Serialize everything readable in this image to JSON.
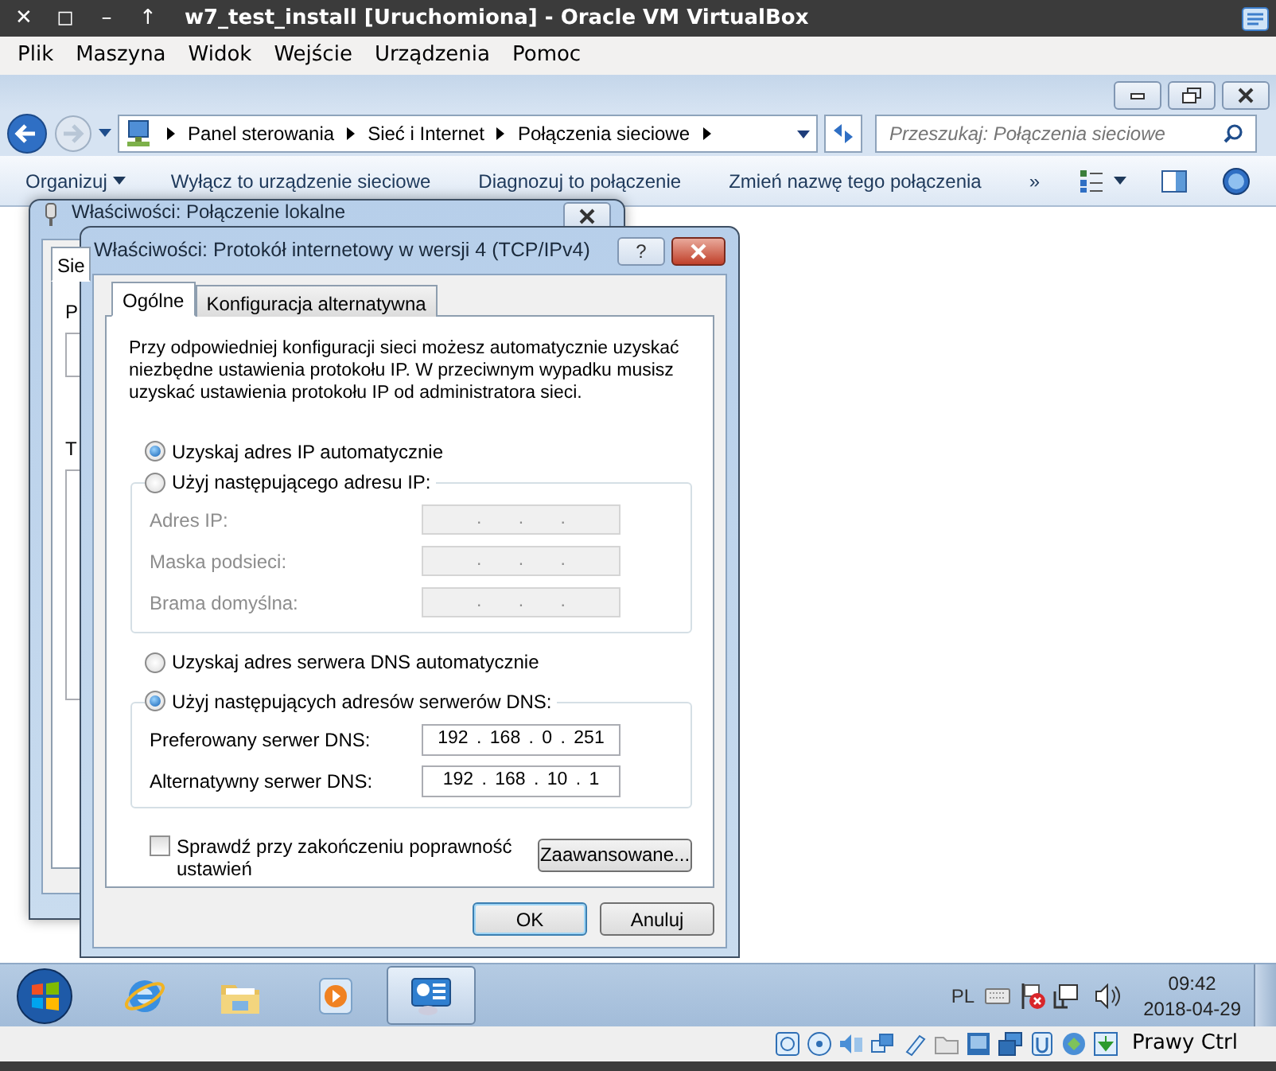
{
  "host_window": {
    "controls": [
      "✕",
      "◻",
      "–",
      "↑"
    ],
    "title": "w7_test_install [Uruchomiona] - Oracle VM VirtualBox"
  },
  "host_menu": [
    "Plik",
    "Maszyna",
    "Widok",
    "Wejście",
    "Urządzenia",
    "Pomoc"
  ],
  "explorer": {
    "breadcrumb": [
      "Panel sterowania",
      "Sieć i Internet",
      "Połączenia sieciowe"
    ],
    "search": {
      "placeholder": "Przeszukaj: Połączenia sieciowe"
    },
    "toolbar": [
      {
        "label": "Organizuj",
        "dropdown": true
      },
      {
        "label": "Wyłącz to urządzenie sieciowe",
        "dropdown": false
      },
      {
        "label": "Diagnozuj to połączenie",
        "dropdown": false
      },
      {
        "label": "Zmień nazwę tego połączenia",
        "dropdown": false
      },
      {
        "label": "»",
        "dropdown": false
      }
    ]
  },
  "back_dialog": {
    "title": "Właściwości: Połączenie lokalne",
    "tab": "Sie",
    "labels": [
      "P",
      "T"
    ]
  },
  "dialog": {
    "title": "Właściwości: Protokół internetowy w wersji 4 (TCP/IPv4)",
    "help_button": "?",
    "tabs": [
      {
        "label": "Ogólne",
        "selected": true
      },
      {
        "label": "Konfiguracja alternatywna",
        "selected": false
      }
    ],
    "intro": "Przy odpowiedniej konfiguracji sieci możesz automatycznie uzyskać niezbędne ustawienia protokołu IP. W przeciwnym wypadku musisz uzyskać ustawienia protokołu IP od administratora sieci.",
    "ip_options": [
      {
        "label": "Uzyskaj adres IP automatycznie",
        "selected": true
      },
      {
        "label": "Użyj następującego adresu IP:",
        "selected": false
      }
    ],
    "ip_fields": [
      {
        "label": "Adres IP:",
        "value": ". . .",
        "disabled": true
      },
      {
        "label": "Maska podsieci:",
        "value": ". . .",
        "disabled": true
      },
      {
        "label": "Brama domyślna:",
        "value": ". . .",
        "disabled": true
      }
    ],
    "dns_options": [
      {
        "label": "Uzyskaj adres serwera DNS automatycznie",
        "selected": false
      },
      {
        "label": "Użyj następujących adresów serwerów DNS:",
        "selected": true
      }
    ],
    "dns_fields": [
      {
        "label": "Preferowany serwer DNS:",
        "value": "192 . 168 . 0 . 251",
        "disabled": false
      },
      {
        "label": "Alternatywny serwer DNS:",
        "value": "192 . 168 . 10 . 1",
        "disabled": false
      }
    ],
    "validate": {
      "label": "Sprawdź przy zakończeniu poprawność ustawień",
      "checked": false
    },
    "advanced_button": "Zaawansowane...",
    "buttons": [
      {
        "label": "OK",
        "default": true
      },
      {
        "label": "Anuluj",
        "default": false
      }
    ]
  },
  "taskbar": {
    "apps": [
      {
        "kind": "browser",
        "selected": false
      },
      {
        "kind": "folder",
        "selected": false
      },
      {
        "kind": "media",
        "selected": false
      },
      {
        "kind": "control-panel",
        "selected": true
      }
    ],
    "language": "PL",
    "time": "09:42",
    "date": "2018-04-29"
  },
  "status_bar": {
    "host_key": "Prawy Ctrl"
  }
}
